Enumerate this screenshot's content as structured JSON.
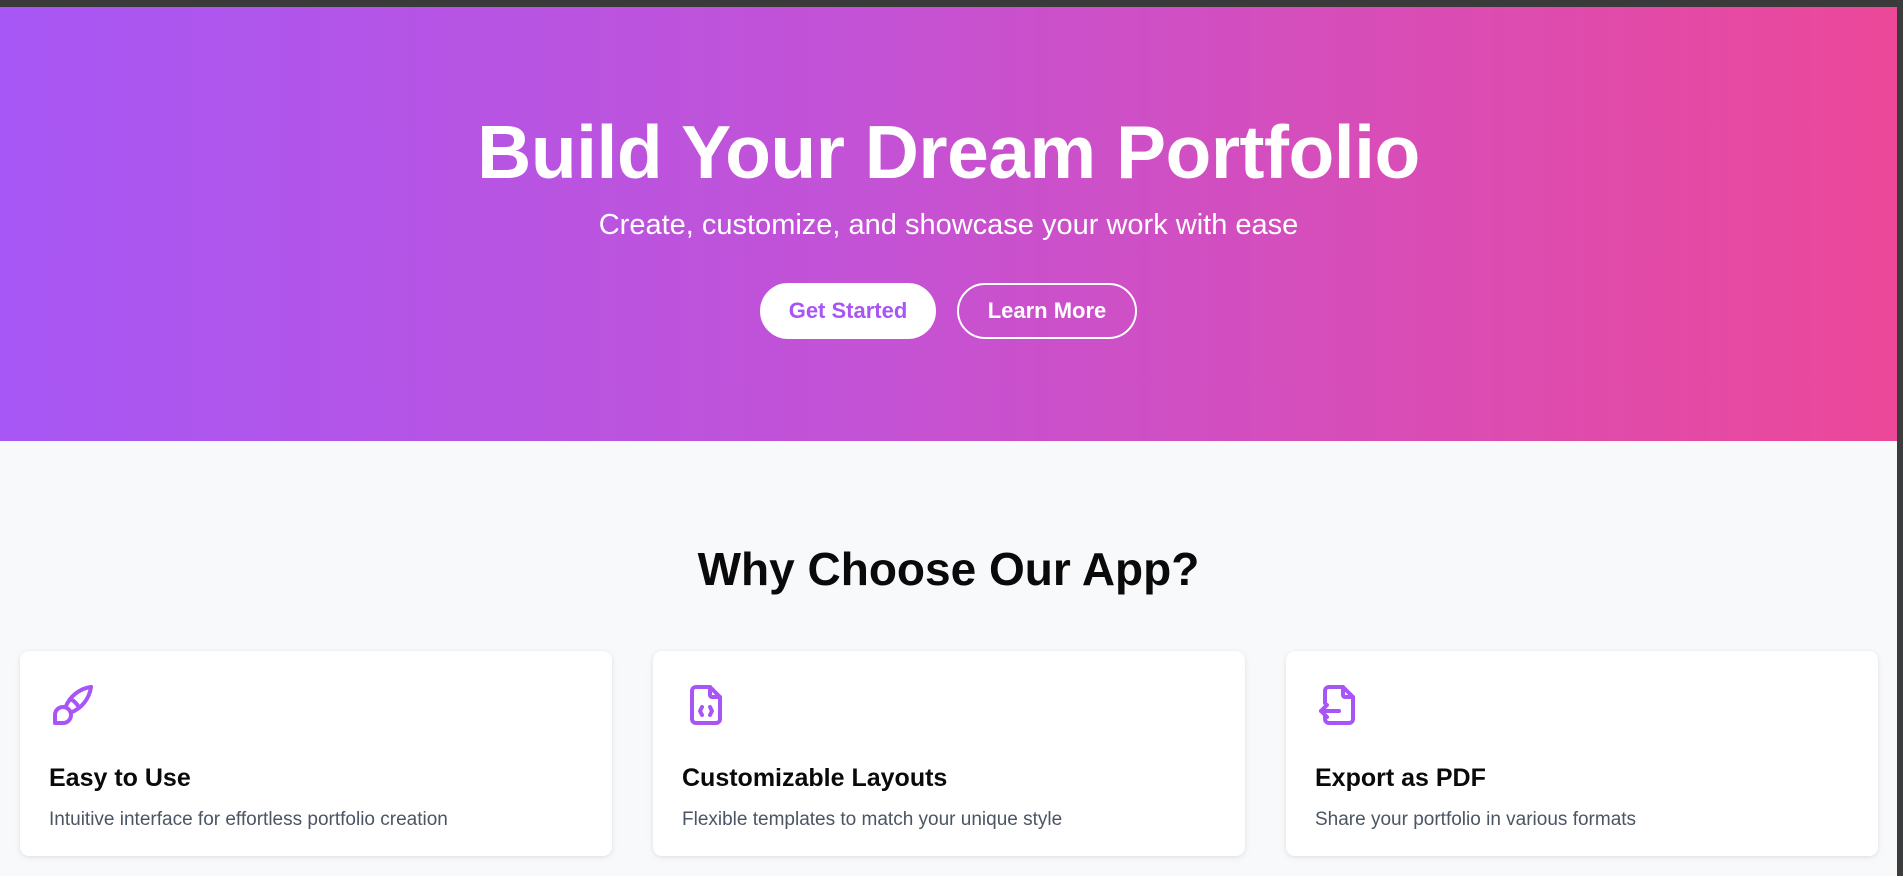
{
  "hero": {
    "title": "Build Your Dream Portfolio",
    "subtitle": "Create, customize, and showcase your work with ease",
    "primary_button": "Get Started",
    "secondary_button": "Learn More",
    "gradient_start": "#a855f7",
    "gradient_end": "#ec4899"
  },
  "features": {
    "title": "Why Choose Our App?",
    "accent": "#a855f7",
    "items": [
      {
        "icon": "paintbrush-icon",
        "title": "Easy to Use",
        "description": "Intuitive interface for effortless portfolio creation"
      },
      {
        "icon": "file-code-icon",
        "title": "Customizable Layouts",
        "description": "Flexible templates to match your unique style"
      },
      {
        "icon": "file-export-icon",
        "title": "Export as PDF",
        "description": "Share your portfolio in various formats"
      }
    ]
  }
}
